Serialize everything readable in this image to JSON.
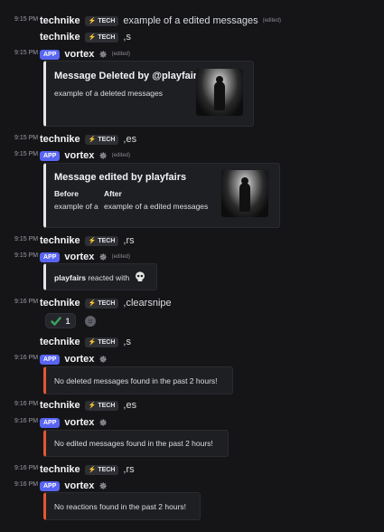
{
  "badges": {
    "tech": "TECH",
    "app": "APP"
  },
  "users": {
    "technike": "technike",
    "vortex": "vortex",
    "playfairs": "playfairs"
  },
  "edited_label": "(edited)",
  "messages": [
    {
      "ts": "9:15 PM",
      "text": "example of a edited messages"
    },
    {
      "text": ",s"
    },
    {
      "ts": "9:15 PM"
    },
    {
      "ts": "9:15 PM",
      "text": ",es"
    },
    {
      "ts": "9:15 PM"
    },
    {
      "ts": "9:15 PM",
      "text": ",rs"
    },
    {
      "ts": "9:15 PM"
    },
    {
      "ts": "9:16 PM",
      "text": ",clearsnipe"
    },
    {
      "text": ",s"
    },
    {
      "ts": "9:16 PM"
    },
    {
      "ts": "9:16 PM",
      "text": ",es"
    },
    {
      "ts": "9:16 PM"
    },
    {
      "ts": "9:16 PM",
      "text": ",rs"
    },
    {
      "ts": "9:16 PM"
    }
  ],
  "embeds": {
    "deleted": {
      "title": "Message Deleted by @playfairs",
      "desc": "example of a deleted messages"
    },
    "edited": {
      "title": "Message edited by playfairs",
      "before_label": "Before",
      "after_label": "After",
      "before_value": "example of a",
      "after_value": "example of a edited messages"
    },
    "reacted": {
      "user": "playfairs",
      "text": "reacted with",
      "emoji": "skull"
    },
    "no_deleted": "No deleted messages found in the past 2 hours!",
    "no_edited": "No edited messages found in the past 2 hours!",
    "no_reactions": "No reactions found in the past 2 hours!"
  },
  "reactions": {
    "check_count": "1",
    "check_emoji": "white-check-mark"
  },
  "colors": {
    "app_badge": "#5865f2",
    "embed_bar_gray": "#e3e5e8",
    "embed_bar_red": "#e4572e",
    "check_green": "#3ba55d"
  }
}
